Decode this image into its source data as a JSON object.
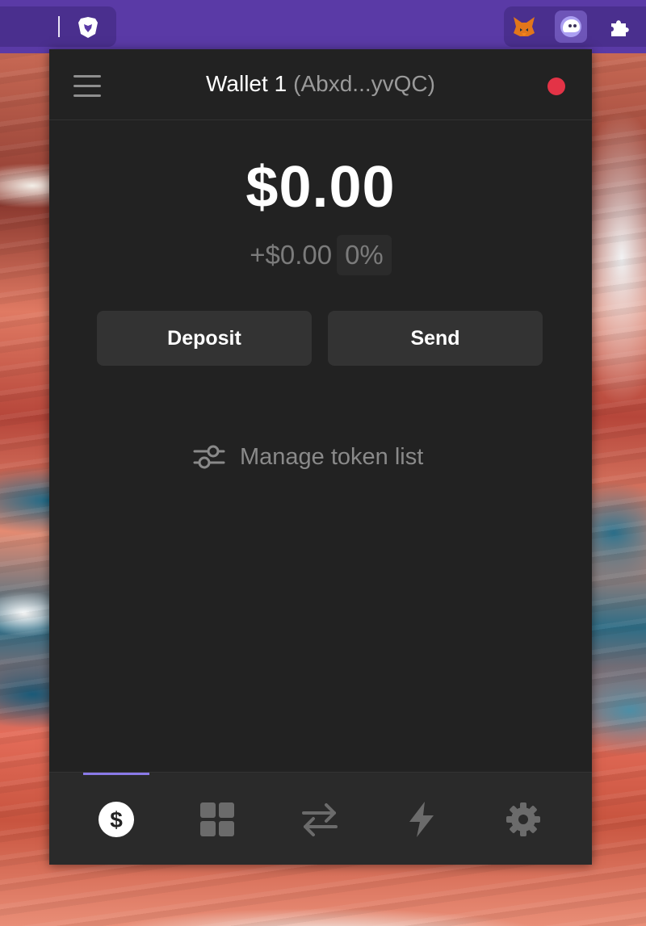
{
  "browser": {
    "extensions": [
      "metamask-icon",
      "phantom-icon",
      "puzzle-icon"
    ],
    "accent_color": "#5a3aa6"
  },
  "wallet": {
    "name": "Wallet 1",
    "address_short": "(Abxd...yvQC)",
    "status_color": "#e33346"
  },
  "balance": {
    "total": "$0.00",
    "change": "+$0.00",
    "change_pct": "0%"
  },
  "actions": {
    "deposit_label": "Deposit",
    "send_label": "Send"
  },
  "manage_tokens_label": "Manage token list",
  "bottom_nav": {
    "items": [
      "dollar-icon",
      "grid-icon",
      "swap-icon",
      "lightning-icon",
      "gear-icon"
    ],
    "active_index": 0,
    "indicator_color": "#8a7ae8"
  }
}
